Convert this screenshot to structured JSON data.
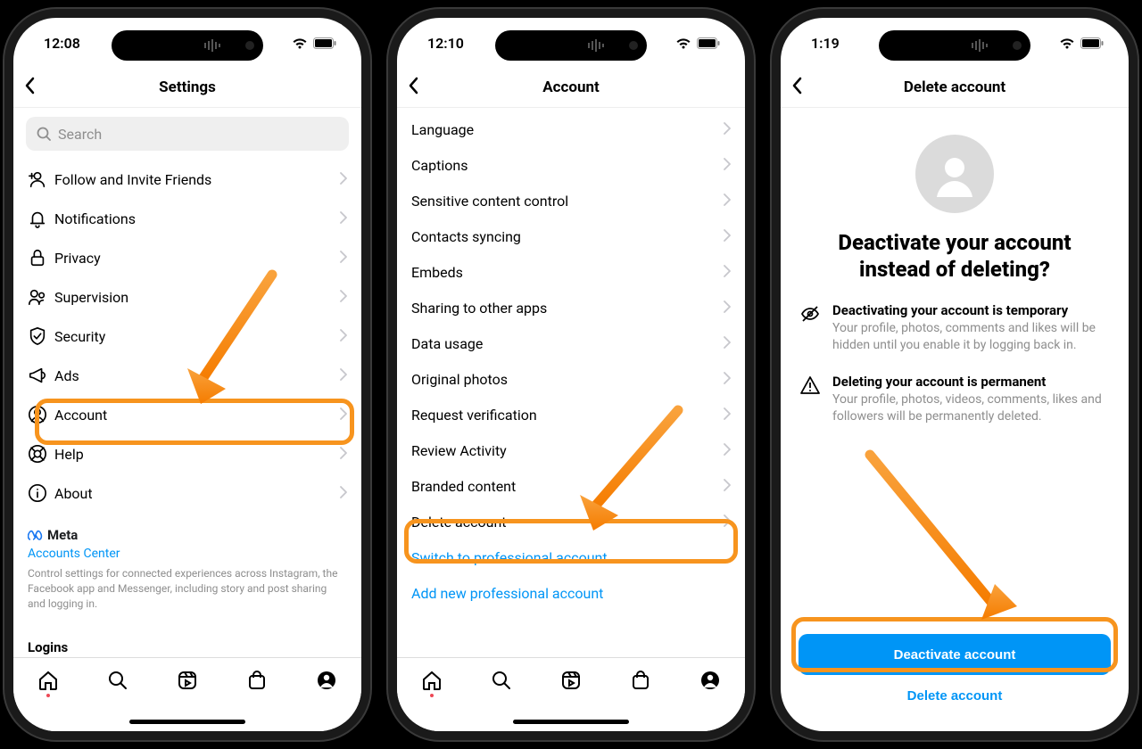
{
  "screen1": {
    "time": "12:08",
    "title": "Settings",
    "search_placeholder": "Search",
    "items": [
      {
        "label": "Follow and Invite Friends",
        "icon": "user-plus"
      },
      {
        "label": "Notifications",
        "icon": "bell"
      },
      {
        "label": "Privacy",
        "icon": "lock"
      },
      {
        "label": "Supervision",
        "icon": "users"
      },
      {
        "label": "Security",
        "icon": "shield"
      },
      {
        "label": "Ads",
        "icon": "megaphone"
      },
      {
        "label": "Account",
        "icon": "user-circle"
      },
      {
        "label": "Help",
        "icon": "lifebuoy"
      },
      {
        "label": "About",
        "icon": "info"
      }
    ],
    "meta_brand": "Meta",
    "accounts_center": "Accounts Center",
    "meta_desc": "Control settings for connected experiences across Instagram, the Facebook app and Messenger, including story and post sharing and logging in.",
    "logins": "Logins",
    "highlight_index": 6
  },
  "screen2": {
    "time": "12:10",
    "title": "Account",
    "items": [
      "Language",
      "Captions",
      "Sensitive content control",
      "Contacts syncing",
      "Embeds",
      "Sharing to other apps",
      "Data usage",
      "Original photos",
      "Request verification",
      "Review Activity",
      "Branded content",
      "Delete account"
    ],
    "link1": "Switch to professional account",
    "link2": "Add new professional account",
    "highlight_index": 11
  },
  "screen3": {
    "time": "1:19",
    "title": "Delete account",
    "headline": "Deactivate your account instead of deleting?",
    "info1_title": "Deactivating your account is temporary",
    "info1_desc": "Your profile, photos, comments and likes will be hidden until you enable it by logging back in.",
    "info2_title": "Deleting your account is permanent",
    "info2_desc": "Your profile, photos, videos, comments, likes and followers will be permanently deleted.",
    "primary_btn": "Deactivate account",
    "secondary_btn": "Delete account"
  }
}
